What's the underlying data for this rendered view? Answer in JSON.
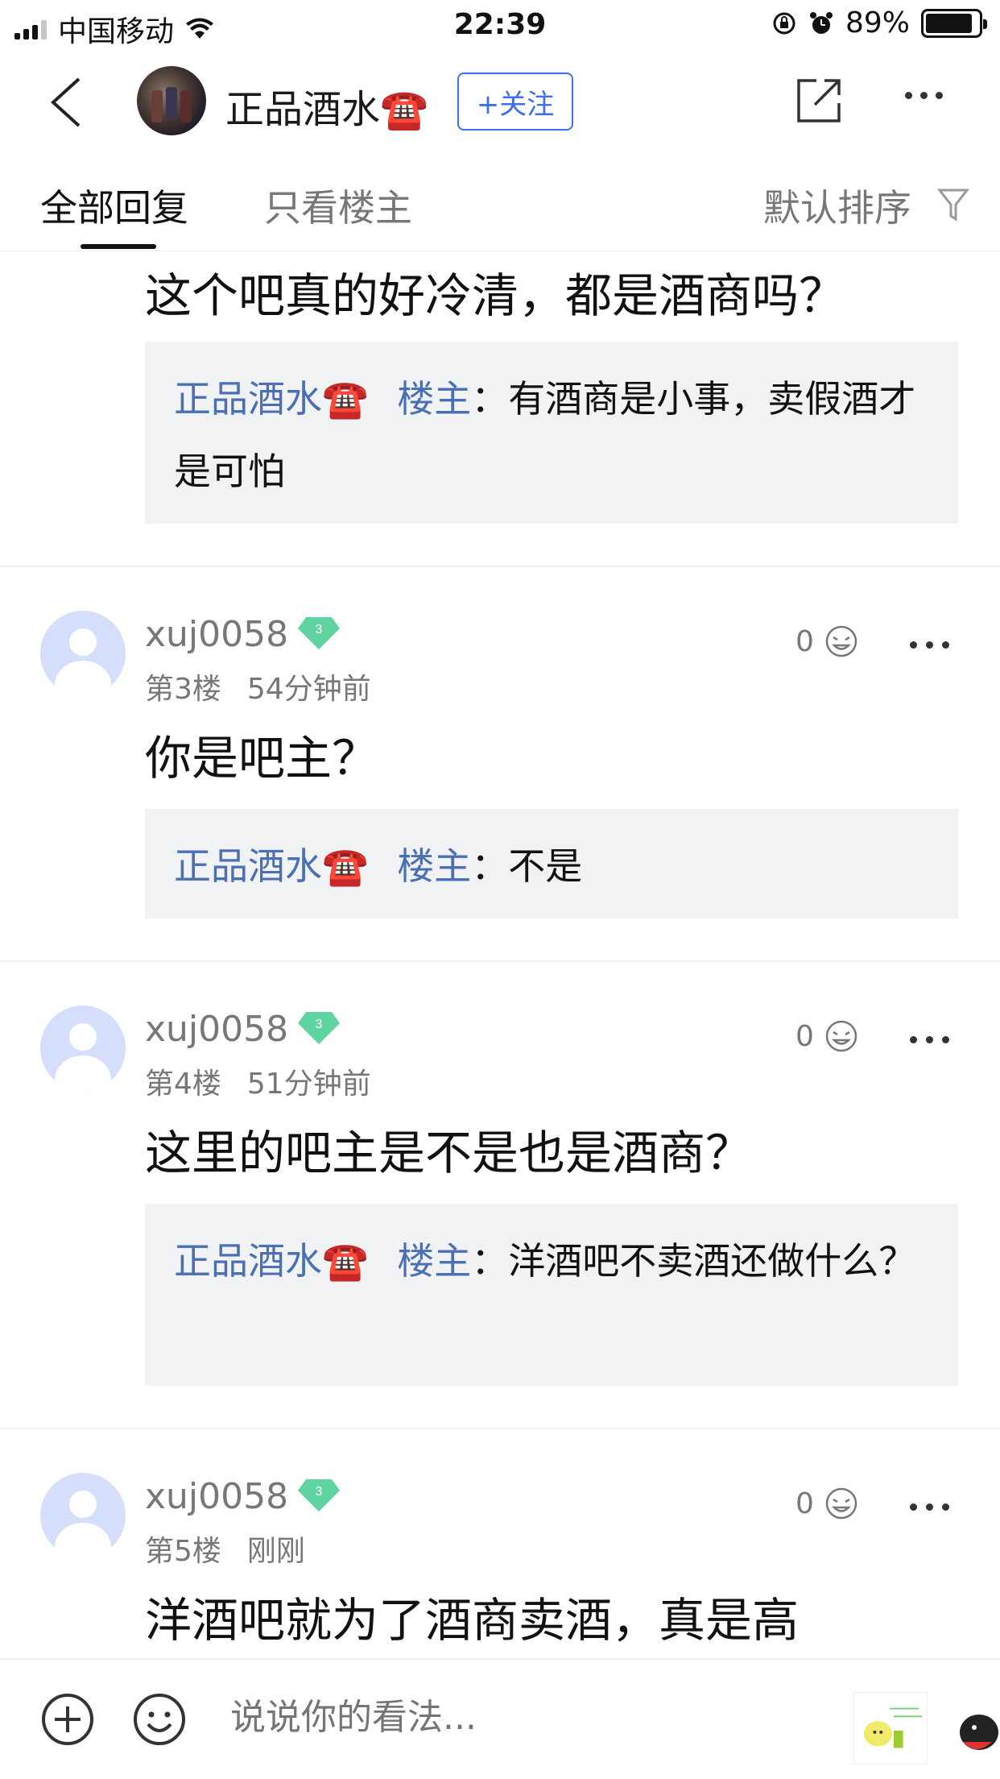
{
  "status_bar": {
    "carrier": "中国移动",
    "time": "22:39",
    "battery": "89%",
    "battery_level": 0.89
  },
  "nav": {
    "title": "正品酒水☎️",
    "follow_label": "+关注"
  },
  "tabs": {
    "all": "全部回复",
    "owner_only": "只看楼主",
    "sort": "默认排序"
  },
  "thread": {
    "partial_post": {
      "text": "这个吧真的好冷清，都是酒商吗？",
      "reply": {
        "author": "正品酒水☎️",
        "owner_tag": "楼主",
        "text": "：有酒商是小事，卖假酒才是可怕"
      }
    },
    "posts": [
      {
        "username": "xuj0058",
        "level": "3",
        "floor": "第3楼",
        "time": "54分钟前",
        "likes": "0",
        "text": "你是吧主？",
        "reply": {
          "author": "正品酒水☎️",
          "owner_tag": "楼主",
          "text": "：不是"
        }
      },
      {
        "username": "xuj0058",
        "level": "3",
        "floor": "第4楼",
        "time": "51分钟前",
        "likes": "0",
        "text": "这里的吧主是不是也是酒商？",
        "reply": {
          "author": "正品酒水☎️",
          "owner_tag": "楼主",
          "text": "：洋酒吧不卖酒还做什么？"
        }
      },
      {
        "username": "xuj0058",
        "level": "3",
        "floor": "第5楼",
        "time": "刚刚",
        "likes": "0",
        "text": "洋酒吧就为了酒商卖酒，真是高"
      }
    ]
  },
  "bottom": {
    "placeholder": "说说你的看法..."
  },
  "colors": {
    "accent": "#3c6ff0",
    "link": "#4a6fb5",
    "quote_bg": "#f1f2f4",
    "level_badge": "#5fd3a0"
  }
}
